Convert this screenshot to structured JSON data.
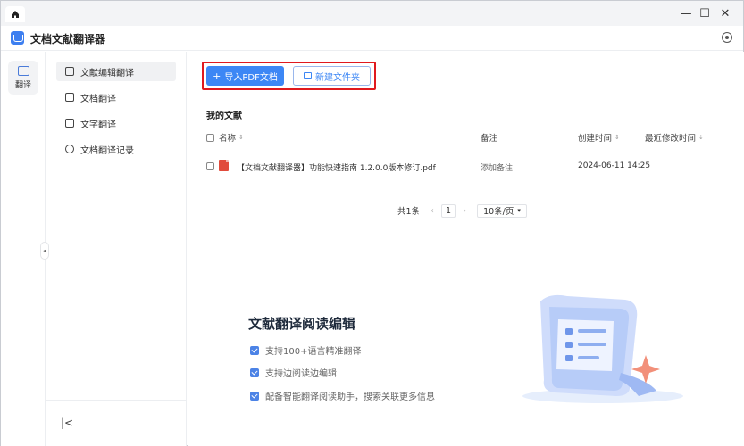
{
  "app": {
    "title": "文档文献翻译器"
  },
  "window_controls": {
    "minimize": "—",
    "maximize": "☐",
    "close": "✕"
  },
  "rail": {
    "label": "翻译"
  },
  "sidebar": {
    "items": [
      {
        "label": "文献编辑翻译",
        "icon": "edit-doc-icon",
        "active": true
      },
      {
        "label": "文档翻译",
        "icon": "document-icon",
        "active": false
      },
      {
        "label": "文字翻译",
        "icon": "text-icon",
        "active": false
      },
      {
        "label": "文档翻译记录",
        "icon": "history-icon",
        "active": false
      }
    ],
    "collapse_label": "|<"
  },
  "toolbar": {
    "import_pdf": "导入PDF文档",
    "new_folder": "新建文件夹"
  },
  "library": {
    "title": "我的文献",
    "columns": {
      "name": "名称",
      "note": "备注",
      "created": "创建时间",
      "modified": "最近修改时间"
    },
    "rows": [
      {
        "name": "【文档文献翻译器】功能快速指南 1.2.0.0版本修订.pdf",
        "note": "添加备注",
        "created": "2024-06-11 14:25",
        "modified": ""
      }
    ]
  },
  "pagination": {
    "total": "共1条",
    "prev": "‹",
    "page": "1",
    "next": "›",
    "page_size": "10条/页"
  },
  "promo": {
    "title": "文献翻译阅读编辑",
    "features": [
      "支持100+语言精准翻译",
      "支持边阅读边编辑",
      "配备智能翻译阅读助手，搜索关联更多信息"
    ]
  },
  "colors": {
    "accent": "#3d87f5",
    "highlight_border": "#e0191e",
    "pdf_icon": "#e14b3c"
  }
}
